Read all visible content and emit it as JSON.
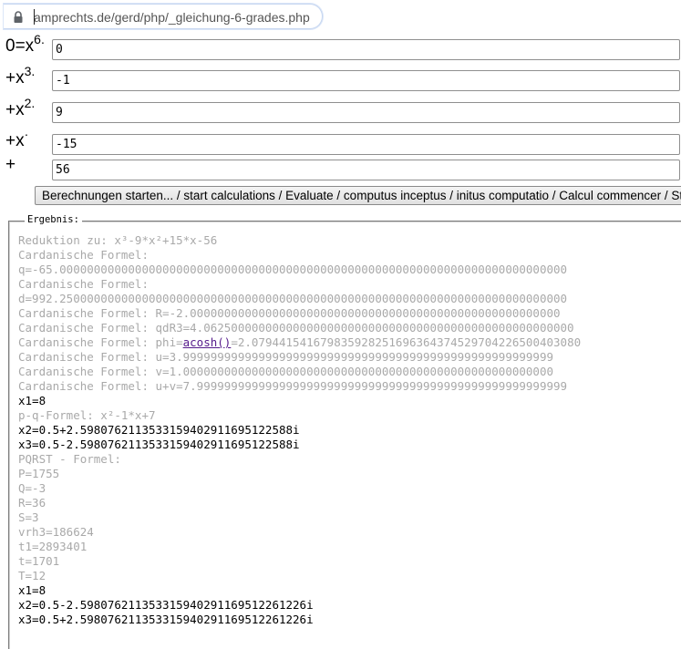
{
  "browser": {
    "url": "amprechts.de/gerd/php/_gleichung-6-grades.php"
  },
  "equation": {
    "rows": [
      {
        "label": "0=x",
        "sup": "6.",
        "value": "0"
      },
      {
        "label": "+x",
        "sup": "3.",
        "value": "-1"
      },
      {
        "label": "+x",
        "sup": "2.",
        "value": "9"
      },
      {
        "label": "+x",
        "sup": "·",
        "value": "-15"
      },
      {
        "label": "+",
        "sup": "",
        "value": "56"
      }
    ],
    "start_label": "Berechnungen starten... / start calculations / Evaluate / computus inceptus / initus computatio / Calcul commencer / Sta"
  },
  "result": {
    "legend": "Ergebnis:",
    "lines": [
      {
        "text": "Reduktion zu: x³-9*x²+15*x-56",
        "tone": "muted"
      },
      {
        "text": "Cardanische Formel:",
        "tone": "muted"
      },
      {
        "text": "q=-65.00000000000000000000000000000000000000000000000000000000000000000000000000",
        "tone": "muted"
      },
      {
        "text": "Cardanische Formel:",
        "tone": "muted"
      },
      {
        "text": "d=992.25000000000000000000000000000000000000000000000000000000000000000000000000",
        "tone": "muted"
      },
      {
        "text": "Cardanische Formel: R=-2.000000000000000000000000000000000000000000000000000000",
        "tone": "muted"
      },
      {
        "text": "Cardanische Formel: qdR3=4.062500000000000000000000000000000000000000000000000000",
        "tone": "muted"
      },
      {
        "text": "Cardanische Formel: phi=",
        "link": "acosh()",
        "after": "=2.079441541679835928251696364374529704226500403080",
        "tone": "muted"
      },
      {
        "text": "Cardanische Formel: u=3.999999999999999999999999999999999999999999999999999999",
        "tone": "muted"
      },
      {
        "text": "Cardanische Formel: v=1.000000000000000000000000000000000000000000000000000000",
        "tone": "muted"
      },
      {
        "text": "Cardanische Formel: u+v=7.999999999999999999999999999999999999999999999999999999",
        "tone": "muted"
      },
      {
        "text": "x1=8",
        "tone": "strong"
      },
      {
        "text": "p-q-Formel: x²-1*x+7",
        "tone": "muted"
      },
      {
        "text": "x2=0.5+2.5980762113533159402911695122588i",
        "tone": "strong"
      },
      {
        "text": "x3=0.5-2.5980762113533159402911695122588i",
        "tone": "strong"
      },
      {
        "text": "PQRST - Formel:",
        "tone": "muted"
      },
      {
        "text": "P=1755",
        "tone": "muted"
      },
      {
        "text": "Q=-3",
        "tone": "muted"
      },
      {
        "text": "R=36",
        "tone": "muted"
      },
      {
        "text": "S=3",
        "tone": "muted"
      },
      {
        "text": "vrh3=186624",
        "tone": "muted"
      },
      {
        "text": "t1=2893401",
        "tone": "muted"
      },
      {
        "text": "t=1701",
        "tone": "muted"
      },
      {
        "text": "T=12",
        "tone": "muted"
      },
      {
        "text": "x1=8",
        "tone": "strong"
      },
      {
        "text": "x2=0.5-2.598076211353315940291169512261226i",
        "tone": "strong"
      },
      {
        "text": "x3=0.5+2.598076211353315940291169512261226i",
        "tone": "strong"
      }
    ]
  }
}
